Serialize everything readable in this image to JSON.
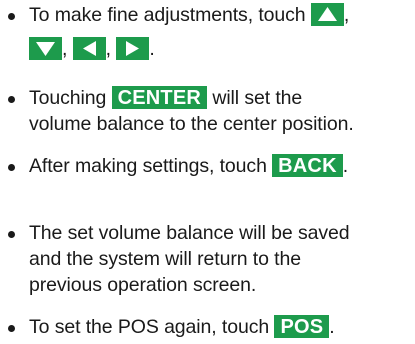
{
  "items": [
    {
      "text_before": "To make fine adjustments, touch ",
      "keys": {
        "up": "up-arrow-icon",
        "down": "down-arrow-icon",
        "left": "left-arrow-icon",
        "right": "right-arrow-icon"
      },
      "separator": ",",
      "end_punct": "."
    },
    {
      "text_before": "Touching ",
      "key_label": "CENTER",
      "text_after_line1": " will set the",
      "line2": "volume balance to the center position."
    },
    {
      "text_before": "After making settings, touch ",
      "key_label": "BACK",
      "text_after": "."
    },
    {
      "line1": "The set volume balance will be saved",
      "line2": "and the system will return to the",
      "line3": "previous operation screen."
    },
    {
      "text_before": "To set the POS again, touch ",
      "key_label": "POS",
      "text_after": "."
    }
  ],
  "colors": {
    "key_background": "#1d9b4c",
    "key_text": "#ffffff",
    "body_text": "#1a1a1a"
  }
}
